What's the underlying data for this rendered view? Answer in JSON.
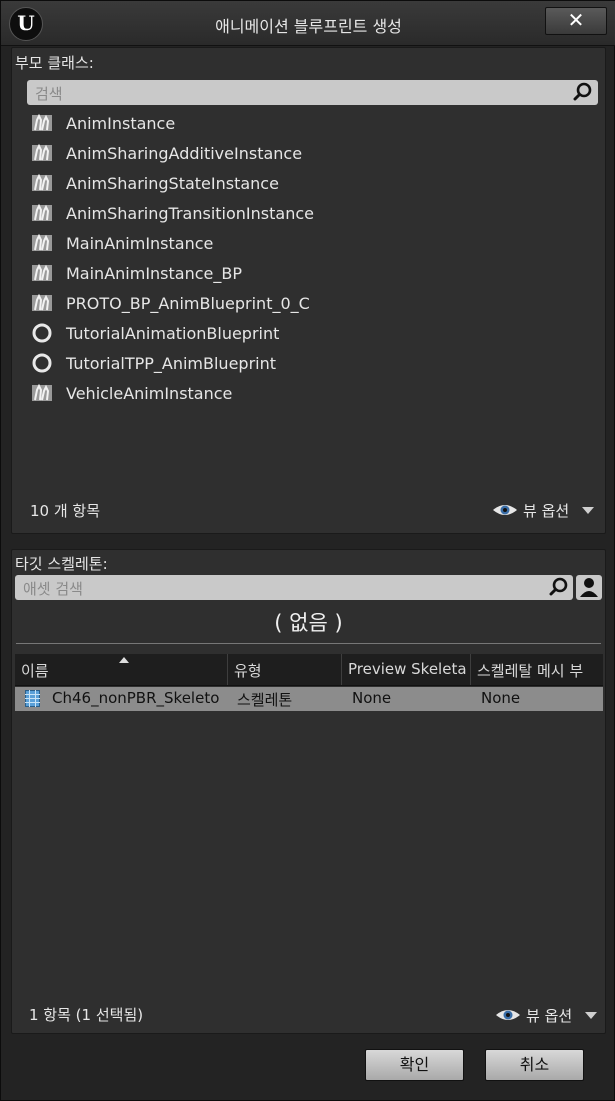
{
  "window": {
    "title": "애니메이션 블루프린트 생성",
    "close_label": "✕",
    "logo_text": "U"
  },
  "parent_class": {
    "label": "부모 클래스:",
    "search_placeholder": "검색",
    "items": [
      {
        "label": "AnimInstance",
        "icon": "anim-instance-icon"
      },
      {
        "label": "AnimSharingAdditiveInstance",
        "icon": "anim-instance-icon"
      },
      {
        "label": "AnimSharingStateInstance",
        "icon": "anim-instance-icon"
      },
      {
        "label": "AnimSharingTransitionInstance",
        "icon": "anim-instance-icon"
      },
      {
        "label": "MainAnimInstance",
        "icon": "anim-instance-icon"
      },
      {
        "label": "MainAnimInstance_BP",
        "icon": "anim-instance-icon"
      },
      {
        "label": "PROTO_BP_AnimBlueprint_0_C",
        "icon": "anim-instance-icon"
      },
      {
        "label": "TutorialAnimationBlueprint",
        "icon": "circle-icon"
      },
      {
        "label": "TutorialTPP_AnimBlueprint",
        "icon": "circle-icon"
      },
      {
        "label": "VehicleAnimInstance",
        "icon": "anim-instance-icon"
      }
    ],
    "count_label": "10 개 항목",
    "view_options_label": "뷰 옵션"
  },
  "target_skeleton": {
    "label": "타깃 스켈레톤:",
    "search_placeholder": "애셋 검색",
    "none_label": "( 없음 )",
    "columns": [
      "이름",
      "유형",
      "Preview Skeleta",
      "스켈레탈 메시 부"
    ],
    "rows": [
      {
        "name": "Ch46_nonPBR_Skeleto",
        "type": "스켈레톤",
        "preview": "None",
        "mesh": "None"
      }
    ],
    "count_label": "1 항목 (1 선택됨)",
    "view_options_label": "뷰 옵션"
  },
  "buttons": {
    "ok": "확인",
    "cancel": "취소"
  },
  "colors": {
    "background": "#232323",
    "panel": "#2f2f2f",
    "selected_row": "#8c8c8c",
    "search_field": "#c9c9c9"
  }
}
